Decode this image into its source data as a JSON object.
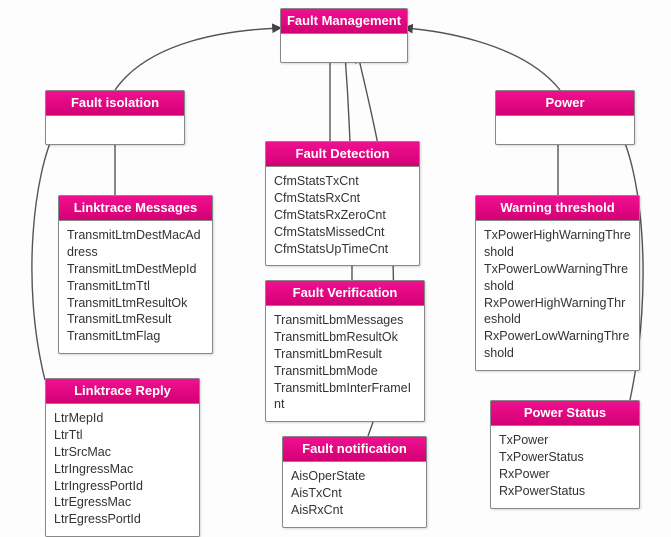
{
  "colors": {
    "accent": "#e6007e"
  },
  "root": {
    "title": "Fault Management"
  },
  "faultIsolation": {
    "title": "Fault isolation",
    "linktraceMessages": {
      "title": "Linktrace Messages",
      "items": [
        "TransmitLtmDestMacAddress",
        "TransmitLtmDestMepId",
        "TransmitLtmTtl",
        "TransmitLtmResultOk",
        "TransmitLtmResult",
        "TransmitLtmFlag"
      ]
    },
    "linktraceReply": {
      "title": "Linktrace Reply",
      "items": [
        "LtrMepId",
        "LtrTtl",
        "LtrSrcMac",
        "LtrIngressMac",
        "LtrIngressPortId",
        "LtrEgressMac",
        "LtrEgressPortId"
      ]
    }
  },
  "faultDetection": {
    "title": "Fault Detection",
    "items": [
      "CfmStatsTxCnt",
      "CfmStatsRxCnt",
      "CfmStatsRxZeroCnt",
      "CfmStatsMissedCnt",
      "CfmStatsUpTimeCnt"
    ]
  },
  "faultVerification": {
    "title": "Fault Verification",
    "items": [
      "TransmitLbmMessages",
      "TransmitLbmResultOk",
      "TransmitLbmResult",
      "TransmitLbmMode",
      "TransmitLbmInterFrameInt"
    ]
  },
  "faultNotification": {
    "title": "Fault notification",
    "items": [
      "AisOperState",
      "AisTxCnt",
      "AisRxCnt"
    ]
  },
  "power": {
    "title": "Power",
    "warningThreshold": {
      "title": "Warning threshold",
      "items": [
        "TxPowerHighWarningThreshold",
        "TxPowerLowWarningThreshold",
        "RxPowerHighWarningThreshold",
        "RxPowerLowWarningThreshold"
      ]
    },
    "powerStatus": {
      "title": "Power Status",
      "items": [
        "TxPower",
        "TxPowerStatus",
        "RxPower",
        "RxPowerStatus"
      ]
    }
  }
}
